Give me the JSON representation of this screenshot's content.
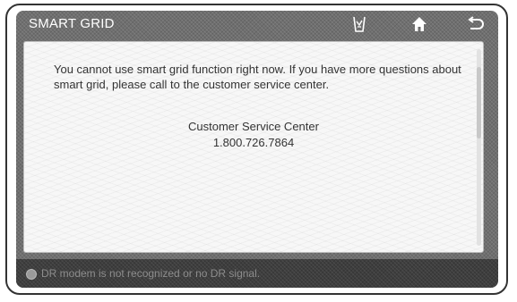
{
  "header": {
    "title": "SMART GRID"
  },
  "toolbar": {
    "icons": [
      "clean-icon",
      "home-icon",
      "back-icon"
    ]
  },
  "dialog": {
    "message": "You cannot use smart grid function right now. If you have more questions about smart grid, please call to the customer service center.",
    "service_center_label": "Customer Service Center",
    "phone": "1.800.726.7864"
  },
  "status": {
    "text": "DR modem is not recognized or no DR signal."
  },
  "colors": {
    "title_bar": "#6f6f6f",
    "panel": "#f7f7f7",
    "status_bar": "#3e3e3e",
    "text": "#333333"
  }
}
